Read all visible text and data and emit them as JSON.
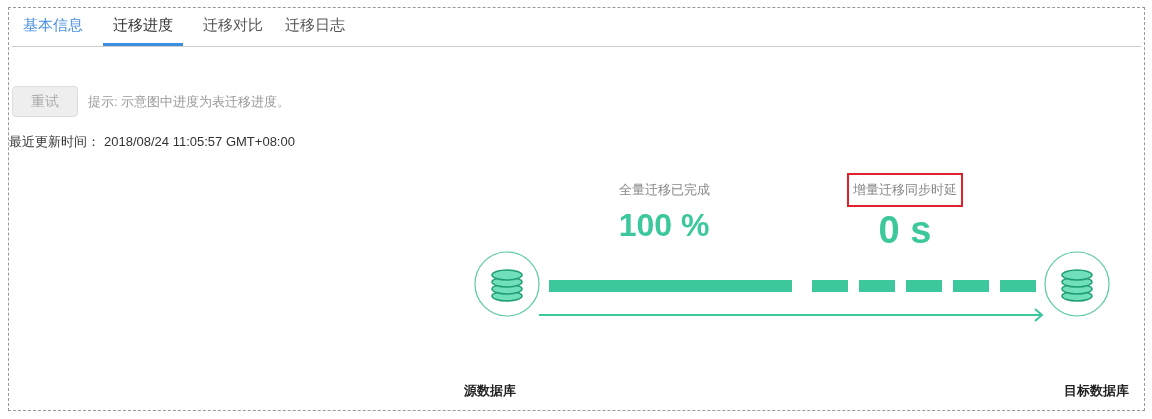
{
  "tabs": [
    {
      "label": "基本信息",
      "selected": false,
      "hovered": true
    },
    {
      "label": "迁移进度",
      "selected": true,
      "hovered": false
    },
    {
      "label": "迁移对比",
      "selected": false,
      "hovered": false
    },
    {
      "label": "迁移日志",
      "selected": false,
      "hovered": false
    }
  ],
  "retry_button": {
    "label": "重试",
    "disabled": true
  },
  "hint": "提示: 示意图中进度为表迁移进度。",
  "last_update": {
    "label": "最近更新时间：",
    "value": "2018/08/24 11:05:57 GMT+08:00"
  },
  "stats": [
    {
      "label": "全量迁移已完成",
      "value": "100 %",
      "highlighted": false
    },
    {
      "label": "增量迁移同步时延",
      "value": "0 s",
      "highlighted": true
    }
  ],
  "source": {
    "label": "源数据库"
  },
  "target": {
    "label": "目标数据库"
  }
}
